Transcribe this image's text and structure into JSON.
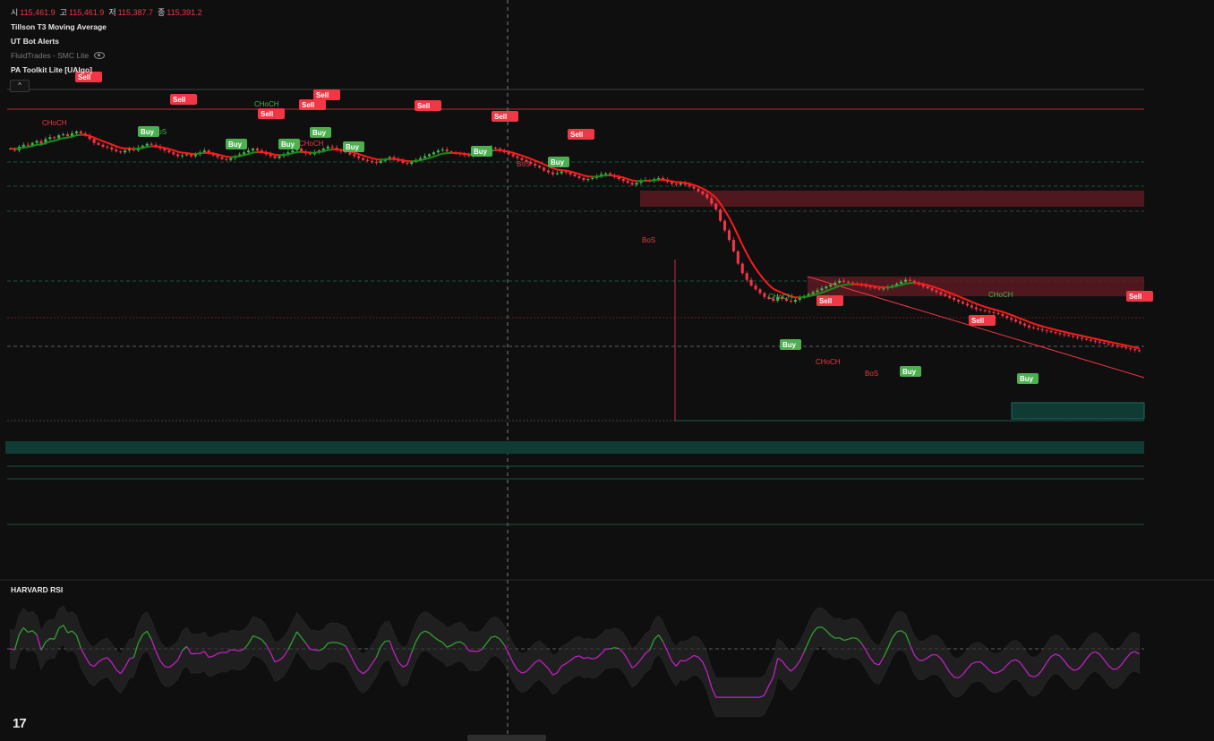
{
  "legend": {
    "ohlc": [
      {
        "key": "시",
        "value": "115,461.9"
      },
      {
        "key": "고",
        "value": "115,461.9"
      },
      {
        "key": "저",
        "value": "115,387.7"
      },
      {
        "key": "종",
        "value": "115,391.2"
      }
    ],
    "indicators": [
      "Tillson T3 Moving Average",
      "UT Bot Alerts",
      "FluidTrades - SMC Lite",
      "PA Toolkit Lite [UAlgo]"
    ]
  },
  "collapse_label": "^",
  "rsi_title": "HARVARD RSI",
  "logo_text": "17",
  "colors": {
    "up": "#4caf50",
    "down": "#f23645",
    "bg": "#0f0f0f",
    "t3_up": "#1b8a1b",
    "t3_down": "#ff1a1a",
    "rsi_up": "#2fa02f",
    "rsi_down": "#c020c0"
  },
  "chart_data": {
    "type": "candlestick",
    "close": [
      115460,
      115440,
      115480,
      115500,
      115490,
      115520,
      115540,
      115510,
      115560,
      115580,
      115570,
      115600,
      115610,
      115590,
      115620,
      115640,
      115620,
      115600,
      115560,
      115520,
      115500,
      115480,
      115470,
      115450,
      115430,
      115420,
      115440,
      115460,
      115440,
      115470,
      115490,
      115510,
      115500,
      115480,
      115460,
      115440,
      115420,
      115400,
      115380,
      115390,
      115400,
      115380,
      115400,
      115420,
      115440,
      115410,
      115390,
      115370,
      115350,
      115340,
      115360,
      115380,
      115400,
      115420,
      115440,
      115460,
      115440,
      115420,
      115400,
      115380,
      115360,
      115380,
      115400,
      115420,
      115440,
      115460,
      115430,
      115410,
      115400,
      115420,
      115440,
      115460,
      115480,
      115470,
      115450,
      115430,
      115420,
      115400,
      115380,
      115360,
      115340,
      115330,
      115320,
      115310,
      115330,
      115350,
      115370,
      115350,
      115330,
      115310,
      115300,
      115320,
      115340,
      115360,
      115380,
      115400,
      115420,
      115440,
      115450,
      115430,
      115420,
      115410,
      115400,
      115390,
      115380,
      115400,
      115420,
      115440,
      115460,
      115470,
      115460,
      115440,
      115420,
      115400,
      115380,
      115360,
      115340,
      115320,
      115300,
      115280,
      115260,
      115230,
      115210,
      115190,
      115200,
      115220,
      115210,
      115190,
      115170,
      115150,
      115130,
      115140,
      115150,
      115170,
      115190,
      115200,
      115180,
      115160,
      115140,
      115120,
      115100,
      115080,
      115100,
      115120,
      115130,
      115120,
      115140,
      115150,
      115130,
      115110,
      115090,
      115080,
      115100,
      115080,
      115060,
      115040,
      115010,
      114980,
      114940,
      114880,
      114820,
      114700,
      114600,
      114500,
      114380,
      114250,
      114150,
      114080,
      114020,
      113980,
      113940,
      113900,
      113880,
      113860,
      113900,
      113880,
      113860,
      113850,
      113870,
      113890,
      113910,
      113930,
      113950,
      113970,
      113990,
      114010,
      114030,
      114050,
      114070,
      114060,
      114050,
      114040,
      114030,
      114020,
      114010,
      114000,
      113990,
      113980,
      113990,
      114000,
      114020,
      114040,
      114060,
      114080,
      114070,
      114050,
      114030,
      114010,
      113990,
      113970,
      113950,
      113930,
      113910,
      113890,
      113870,
      113850,
      113830,
      113810,
      113790,
      113770,
      113760,
      113750,
      113740,
      113730,
      113720,
      113700,
      113680,
      113660,
      113640,
      113620,
      113600,
      113580,
      113570,
      113560,
      113550,
      113540,
      113530,
      113520,
      113510,
      113500,
      113490,
      113480,
      113470,
      113460,
      113450,
      113440,
      113430,
      113420,
      113410,
      113400,
      113390,
      113380,
      113370,
      113360,
      113350,
      113340,
      113330
    ],
    "y_range": [
      111000,
      116100
    ],
    "rsi": {
      "mid": 50,
      "range": [
        20,
        80
      ]
    }
  }
}
